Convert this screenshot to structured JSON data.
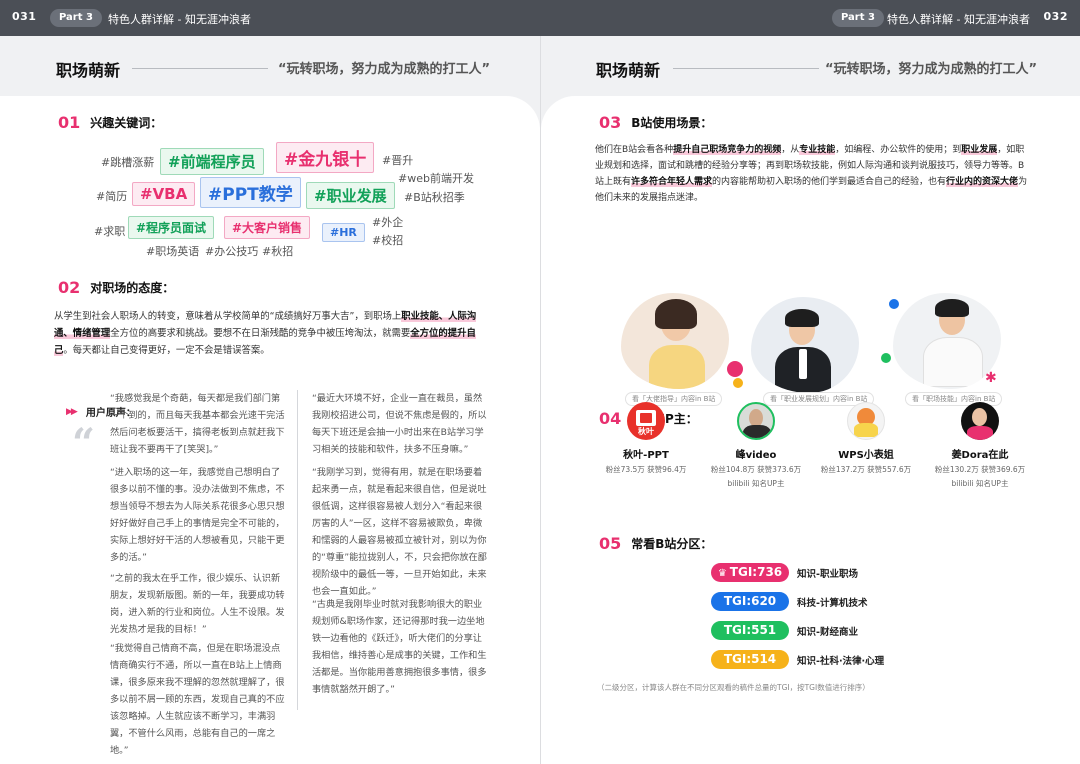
{
  "header": {
    "left_page_number": "031",
    "right_page_number": "032",
    "part_badge": "Part 3",
    "part_title": "特色人群详解 - 知无涯冲浪者"
  },
  "left": {
    "title": "职场萌新",
    "quote": "“玩转职场，努力成为成熟的打工人”",
    "sec1": {
      "num": "01",
      "label": "兴趣关键词："
    },
    "keywords": {
      "k1": "#跳槽涨薪",
      "k2": "#前端程序员",
      "k3": "#金九银十",
      "k4": "#晋升",
      "k5": "#web前端开发",
      "k6": "#简历",
      "k7": "#VBA",
      "k8": "#PPT教学",
      "k9": "#职业发展",
      "k10": "#B站秋招季",
      "k11": "#求职",
      "k12": "#程序员面试",
      "k13": "#大客户销售",
      "k14": "#外企",
      "k15": "#HR",
      "k16": "#校招",
      "k17": "#职场英语",
      "k18": "#办公技巧",
      "k19": "#秋招"
    },
    "sec2": {
      "num": "02",
      "label": "对职场的态度："
    },
    "attitude": {
      "p1": "从学生到社会人职场人的转变，意味着从学校简单的“成绩搞好万事大吉”，到职场上",
      "h1": "职业技能、人际沟通、",
      "h2": "情绪管理",
      "p2": "全方位的高要求和挑战。要想不在日渐残酷的竞争中被压垮淘汰，就需要",
      "h3": "全方位的提升自己",
      "p3": "。每天都让自己变得更好，一定不会是错误答案。"
    },
    "voice_header": "用户原声：",
    "quotes_left": {
      "q1": "“我感觉我是个奇葩，每天都是我们部门第一个到的，而且每天我基本都会光速干完活然后问老板要活干，搞得老板到点就赶我下班让我不要再干了[笑哭]。”",
      "q2": "“进入职场的这一年，我感觉自己想明白了很多以前不懂的事。没办法做到不焦虑，不想当领导不想去为人际关系花很多心思只想好好做好自己手上的事情是完全不可能的，实际上想好好干活的人想被看见，只能干更多的活。”",
      "q3": "“之前的我太在乎工作，很少娱乐、认识新朋友，发现新版图。新的一年，我要成功转岗，进入新的行业和岗位。人生不设限。发光发热才是我的目标！”",
      "q4": "“我觉得自己情商不高，但是在职场混没点情商确实行不通，所以一直在B站上上情商课，很多原来我不理解的忽然就理解了，很多以前不屑一顾的东西，发现自己真的不应该忽略掉。人生就应该不断学习，丰满羽翼，不管什么风雨，总能有自己的一席之地。”"
    },
    "quotes_right": {
      "q1": "“最近大环境不好，企业一直在裁员，虽然我刚校招进公司，但说不焦虑是假的，所以每天下班还是会抽一小时出来在B站学习学习相关的技能和软件，扶多不压身嘛。”",
      "q2": "“我刚学习到，觉得有用，就是在职场要着起来勇一点，就是看起来很自信，但是说吐很低调，这样很容易被人划分入“看起来很厉害的人”一区，这样不容易被欺负，卑微和懦弱的人最容易被孤立被针对，别以为你的“尊重”能拉拢别人，不，只会把你放在鄙视阶级中的最低一等，一旦开始如此，未来也会一直如此。”",
      "q3": "“古典是我刚毕业时就对我影响很大的职业规划师&职场作家，还记得那时我一边坐地铁一边看他的《跃迁》，听大佬们的分享让我相信，维持善心是成事的关键，工作和生活都是。当你能用善意拥抱很多事情，很多事情就豁然开朗了。”"
    }
  },
  "right": {
    "title": "职场萌新",
    "quote": "“玩转职场，努力成为成熟的打工人”",
    "sec3": {
      "num": "03",
      "label": "B站使用场景："
    },
    "scene": {
      "p1": "他们在B站会看各种",
      "h1": "提升自己职场竞争力的视频",
      "p2": "，从",
      "h2": "专业技能",
      "p3": "，如编程、办公软件的使用；到",
      "h3": "职业发展",
      "p4": "，如职业规划和选择，面试和跳槽的经验分享等；再到职场软技能，例如人际沟通和谈判说服技巧，领导力等等。B站上既有",
      "h4": "许多符合年轻人需求",
      "p5": "的内容能帮助初入职场的他们学到最适合自己的经验，也有",
      "h5": "行业内的资深大佬",
      "p6": "为他们未来的发展指点迷津。"
    },
    "captions": {
      "c1": "看「大佬指导」内容in B站",
      "c2": "看「职业发展规划」内容in B站",
      "c3": "看「职场技能」内容in B站"
    },
    "sec4": {
      "num": "04",
      "label": "爱看UP主："
    },
    "up_hosts": [
      {
        "name": "秋叶-PPT",
        "stats": "粉丝73.5万 获赞96.4万",
        "sub": ""
      },
      {
        "name": "峰video",
        "stats": "粉丝104.8万 获赞373.6万",
        "sub": "bilibili 知名UP主"
      },
      {
        "name": "WPS小表姐",
        "stats": "粉丝137.2万 获赞557.6万",
        "sub": ""
      },
      {
        "name": "姜Dora在此",
        "stats": "粉丝130.2万 获赞369.6万",
        "sub": "bilibili 知名UP主"
      }
    ],
    "sec5": {
      "num": "05",
      "label": "常看B站分区："
    },
    "tgi": [
      {
        "value": "TGI:736",
        "label": "知识-职业职场",
        "color": "#e8306f"
      },
      {
        "value": "TGI:620",
        "label": "科技-计算机技术",
        "color": "#1a73e8"
      },
      {
        "value": "TGI:551",
        "label": "知识-财经商业",
        "color": "#1fbf5f"
      },
      {
        "value": "TGI:514",
        "label": "知识-社科·法律·心理",
        "color": "#f6b21a"
      }
    ],
    "note": "（二级分区，计算该人群在不同分区观看的稿件总量的TGI，按TGI数值进行排序）",
    "icon_logo_text": "秋叶"
  },
  "colors": {
    "accent": "#e8306f",
    "blue": "#1a73e8",
    "green": "#1fbf5f",
    "yellow": "#f6b21a"
  }
}
